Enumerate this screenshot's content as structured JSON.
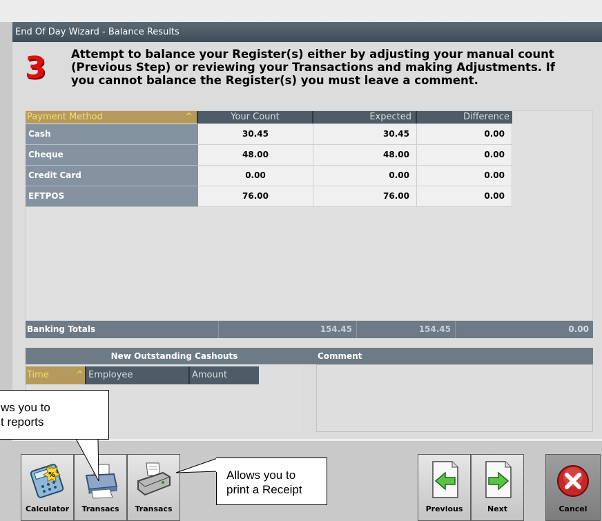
{
  "window": {
    "title": "End Of Day Wizard - Balance Results"
  },
  "step": {
    "number": "3",
    "instruction": "Attempt to balance your Register(s) either by adjusting your manual count (Previous Step) or reviewing your Transactions and making Adjustments. If you cannot balance the Register(s) you must leave a comment."
  },
  "payments": {
    "columns": [
      "Payment Method",
      "Your Count",
      "Expected",
      "Difference"
    ],
    "rows": [
      {
        "method": "Cash",
        "count": "30.45",
        "expected": "30.45",
        "difference": "0.00"
      },
      {
        "method": "Cheque",
        "count": "48.00",
        "expected": "48.00",
        "difference": "0.00"
      },
      {
        "method": "Credit Card",
        "count": "0.00",
        "expected": "0.00",
        "difference": "0.00"
      },
      {
        "method": "EFTPOS",
        "count": "76.00",
        "expected": "76.00",
        "difference": "0.00"
      }
    ]
  },
  "totals": {
    "label": "Banking Totals",
    "count": "154.45",
    "expected": "154.45",
    "difference": "0.00"
  },
  "cashouts": {
    "title": "New Outstanding Cashouts",
    "columns": [
      "Time",
      "Employee",
      "Amount"
    ]
  },
  "comment": {
    "title": "Comment",
    "value": ""
  },
  "buttons": {
    "calculator": "Calculator",
    "transacs_report": "Transacs",
    "transacs_receipt": "Transacs",
    "previous": "Previous",
    "next": "Next",
    "cancel": "Cancel"
  },
  "callouts": {
    "reports": "ws you to\nt reports",
    "receipt": "Allows you to\nprint a Receipt"
  },
  "colors": {
    "accent_sort": "#b49a5c",
    "header": "#4d5c66",
    "title_bar": "#4a5962",
    "cancel_red": "#c62828",
    "step_red": "#e01010"
  }
}
